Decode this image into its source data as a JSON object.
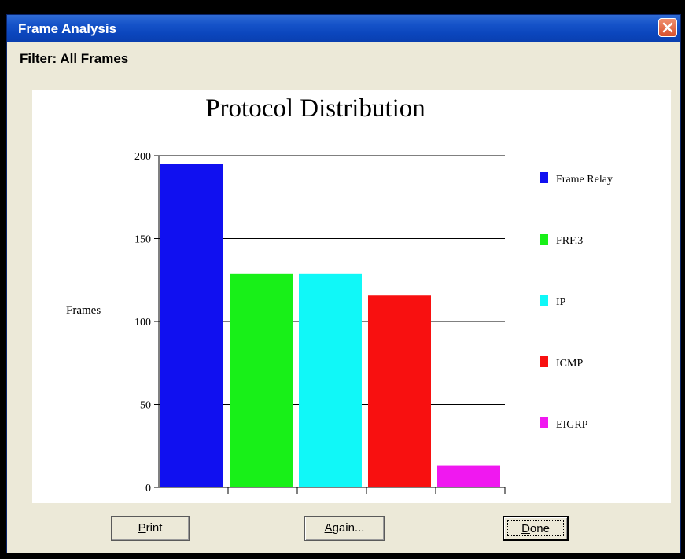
{
  "window": {
    "title": "Frame Analysis"
  },
  "filter_text": "Filter: All Frames",
  "buttons": {
    "print": {
      "mnemonic": "P",
      "rest": "rint"
    },
    "again": {
      "mnemonic": "A",
      "rest": "gain..."
    },
    "done": {
      "mnemonic": "D",
      "rest": "one"
    }
  },
  "chart_data": {
    "type": "bar",
    "title": "Protocol Distribution",
    "ylabel": "Frames",
    "xlabel": "",
    "ylim": [
      0,
      200
    ],
    "yticks": [
      0,
      50,
      100,
      150,
      200
    ],
    "grid": true,
    "legend_position": "right",
    "categories": [
      "Frame Relay",
      "FRF.3",
      "IP",
      "ICMP",
      "EIGRP"
    ],
    "values": [
      195,
      129,
      129,
      116,
      13
    ],
    "colors": [
      "#1010f0",
      "#18f018",
      "#10f8f8",
      "#f81010",
      "#f018f0"
    ]
  }
}
